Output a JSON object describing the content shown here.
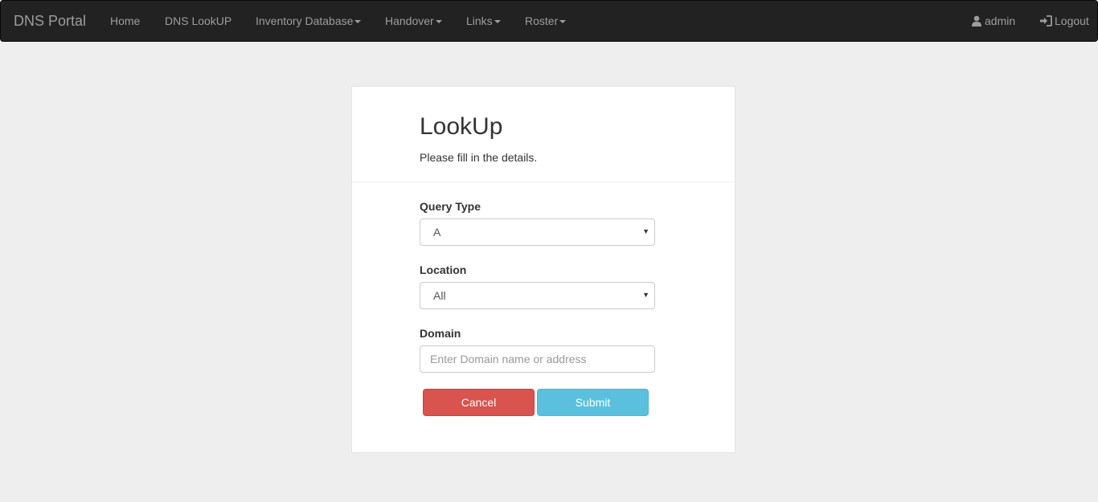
{
  "navbar": {
    "brand": "DNS Portal",
    "items": [
      {
        "label": "Home"
      },
      {
        "label": "DNS LookUP"
      },
      {
        "label": "Inventory Database"
      },
      {
        "label": "Handover"
      },
      {
        "label": "Links"
      },
      {
        "label": "Roster"
      }
    ],
    "user_label": "admin",
    "logout_label": "Logout"
  },
  "form": {
    "title": "LookUp",
    "subtitle": "Please fill in the details.",
    "query_type": {
      "label": "Query Type",
      "value": "A"
    },
    "location": {
      "label": "Location",
      "value": "All"
    },
    "domain": {
      "label": "Domain",
      "placeholder": "Enter Domain name or address",
      "value": ""
    },
    "cancel_label": "Cancel",
    "submit_label": "Submit"
  },
  "colors": {
    "navbar_bg": "#222222",
    "cancel": "#d9534f",
    "submit": "#5bc0de",
    "page_bg": "#eeeeee"
  },
  "icons": {
    "user": "user-icon",
    "logout": "log-in-icon",
    "dropdown": "caret-down-icon"
  }
}
